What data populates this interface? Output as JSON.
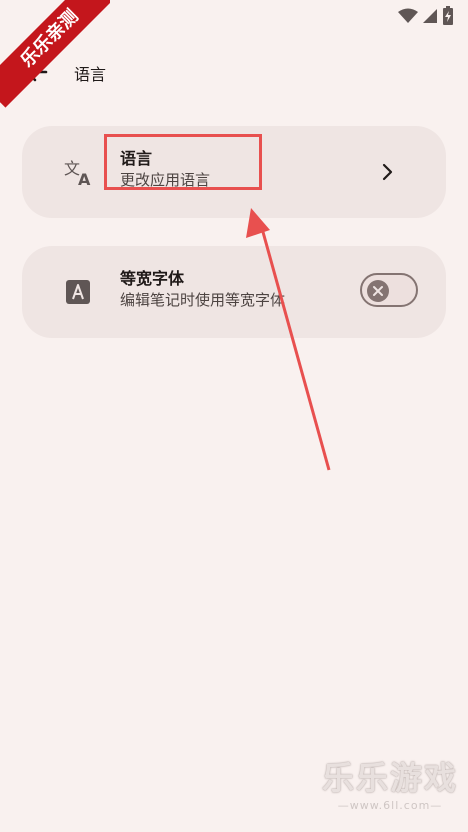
{
  "header": {
    "title": "语言"
  },
  "settings": [
    {
      "title": "语言",
      "subtitle": "更改应用语言"
    },
    {
      "title": "等宽字体",
      "subtitle": "编辑笔记时使用等宽字体",
      "toggle_on": false
    }
  ],
  "watermark": {
    "corner": "乐乐亲测",
    "bottom": "乐乐游戏",
    "url": "—www.6ll.com—"
  },
  "colors": {
    "background": "#f9f1ef",
    "card": "#efe5e3",
    "highlight": "#e8504f",
    "toggle": "#847472",
    "ribbon": "#c4161c"
  }
}
